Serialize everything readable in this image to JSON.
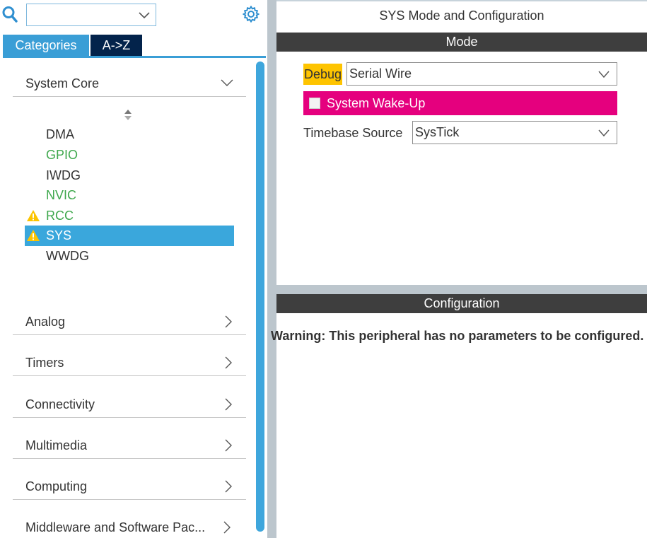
{
  "left_panel": {
    "search": {
      "value": "",
      "icon": "search-icon"
    },
    "settings_icon": "gear-icon",
    "tabs": [
      {
        "label": "Categories",
        "active": true
      },
      {
        "label": "A->Z",
        "active": false
      }
    ],
    "categories": [
      {
        "label": "System Core",
        "expanded": true,
        "items": [
          {
            "label": "DMA",
            "color": "dark",
            "warning": false,
            "selected": false
          },
          {
            "label": "GPIO",
            "color": "green",
            "warning": false,
            "selected": false
          },
          {
            "label": "IWDG",
            "color": "dark",
            "warning": false,
            "selected": false
          },
          {
            "label": "NVIC",
            "color": "green",
            "warning": false,
            "selected": false
          },
          {
            "label": "RCC",
            "color": "green",
            "warning": true,
            "selected": false
          },
          {
            "label": "SYS",
            "color": "green",
            "warning": true,
            "selected": true
          },
          {
            "label": "WWDG",
            "color": "dark",
            "warning": false,
            "selected": false
          }
        ]
      },
      {
        "label": "Analog",
        "expanded": false
      },
      {
        "label": "Timers",
        "expanded": false
      },
      {
        "label": "Connectivity",
        "expanded": false
      },
      {
        "label": "Multimedia",
        "expanded": false
      },
      {
        "label": "Computing",
        "expanded": false
      },
      {
        "label": "Middleware and Software Pac...",
        "expanded": false
      }
    ]
  },
  "right_panel": {
    "title": "SYS Mode and Configuration",
    "mode_header": "Mode",
    "debug": {
      "label": "Debug",
      "value": "Serial Wire"
    },
    "system_wakeup": {
      "label": "System Wake-Up",
      "checked": false
    },
    "timebase": {
      "label": "Timebase Source",
      "value": "SysTick"
    },
    "config_header": "Configuration",
    "warning": "Warning: This peripheral has no parameters to be configured."
  },
  "colors": {
    "accent_blue": "#3aa7dc",
    "tab_dark": "#03234b",
    "green_text": "#3fa84d",
    "wakeup_pink": "#e5007e",
    "debug_highlight": "#fec400",
    "header_bar": "#3e3e3e",
    "warning_yellow": "#fcc400"
  }
}
